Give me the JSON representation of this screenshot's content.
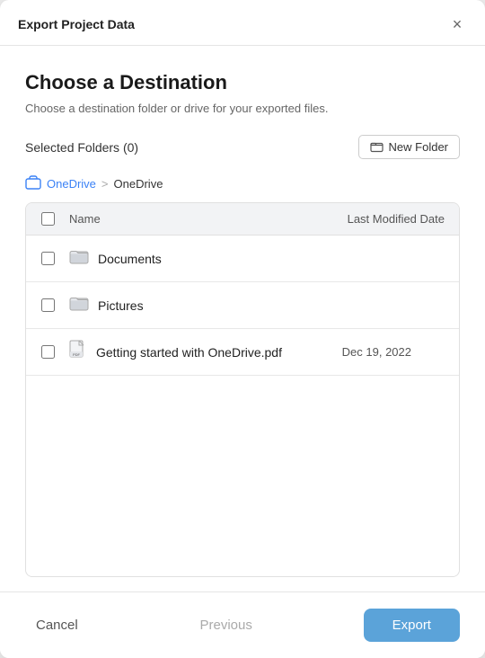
{
  "dialog": {
    "title": "Export Project Data",
    "close_icon": "×"
  },
  "header": {
    "title": "Choose a Destination",
    "subtitle": "Choose a destination folder or drive for your exported files."
  },
  "toolbar": {
    "selected_folders_label": "Selected Folders (0)",
    "new_folder_label": "New Folder"
  },
  "breadcrumb": {
    "icon": "⬡",
    "link_label": "OneDrive",
    "separator": ">",
    "current": "OneDrive"
  },
  "table": {
    "col_name": "Name",
    "col_date": "Last Modified Date",
    "rows": [
      {
        "type": "folder",
        "name": "Documents",
        "date": ""
      },
      {
        "type": "folder",
        "name": "Pictures",
        "date": ""
      },
      {
        "type": "pdf",
        "name": "Getting started with OneDrive.pdf",
        "date": "Dec 19, 2022"
      }
    ]
  },
  "footer": {
    "cancel_label": "Cancel",
    "previous_label": "Previous",
    "export_label": "Export"
  }
}
